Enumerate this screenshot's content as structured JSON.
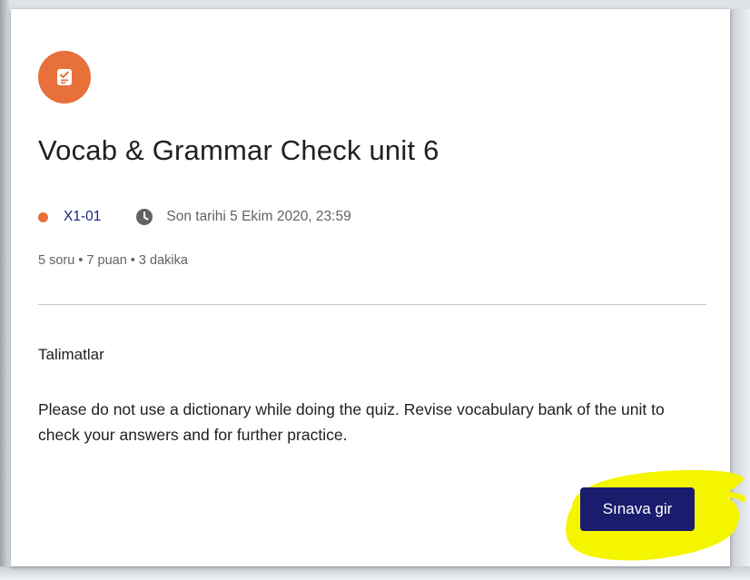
{
  "assignment": {
    "title": "Vocab & Grammar Check unit 6",
    "icon": "quiz-icon",
    "class_name": "X1-01",
    "due_text": "Son tarihi 5 Ekim 2020, 23:59",
    "stats": "5 soru • 7 puan • 3 dakika",
    "instructions_heading": "Talimatlar",
    "instructions_body": "Please do not use a dictionary while doing the quiz. Revise vocabulary bank of the unit to check your answers and for further practice.",
    "start_label": "Sınava gir"
  },
  "colors": {
    "accent_orange": "#e8703a",
    "button_navy": "#1a1c6e",
    "highlight_yellow": "#f5f500"
  }
}
